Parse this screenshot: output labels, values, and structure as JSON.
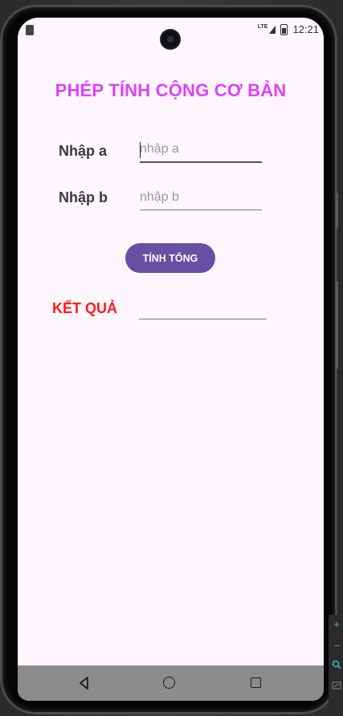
{
  "status_bar": {
    "time": "12:21",
    "network": "LTE"
  },
  "app": {
    "title": "PHÉP TÍNH CỘNG CƠ BẢN",
    "input_a": {
      "label": "Nhập a",
      "placeholder": "nhập a",
      "value": ""
    },
    "input_b": {
      "label": "Nhập b",
      "placeholder": "nhập b",
      "value": ""
    },
    "button_label": "TÍNH TỔNG",
    "result_label": "KẾT QUẢ",
    "result_value": ""
  },
  "nav_bar": {
    "icons": [
      "back-icon",
      "home-icon",
      "recents-icon"
    ]
  },
  "emulator_toolbar": {
    "icons": [
      "plus-icon",
      "minus-icon",
      "zoom-icon",
      "screenshot-icon"
    ]
  },
  "colors": {
    "title": "#e040fb",
    "button": "#6750a4",
    "result_label": "#ff1a1a",
    "screen_bg": "#fdf6fd"
  }
}
